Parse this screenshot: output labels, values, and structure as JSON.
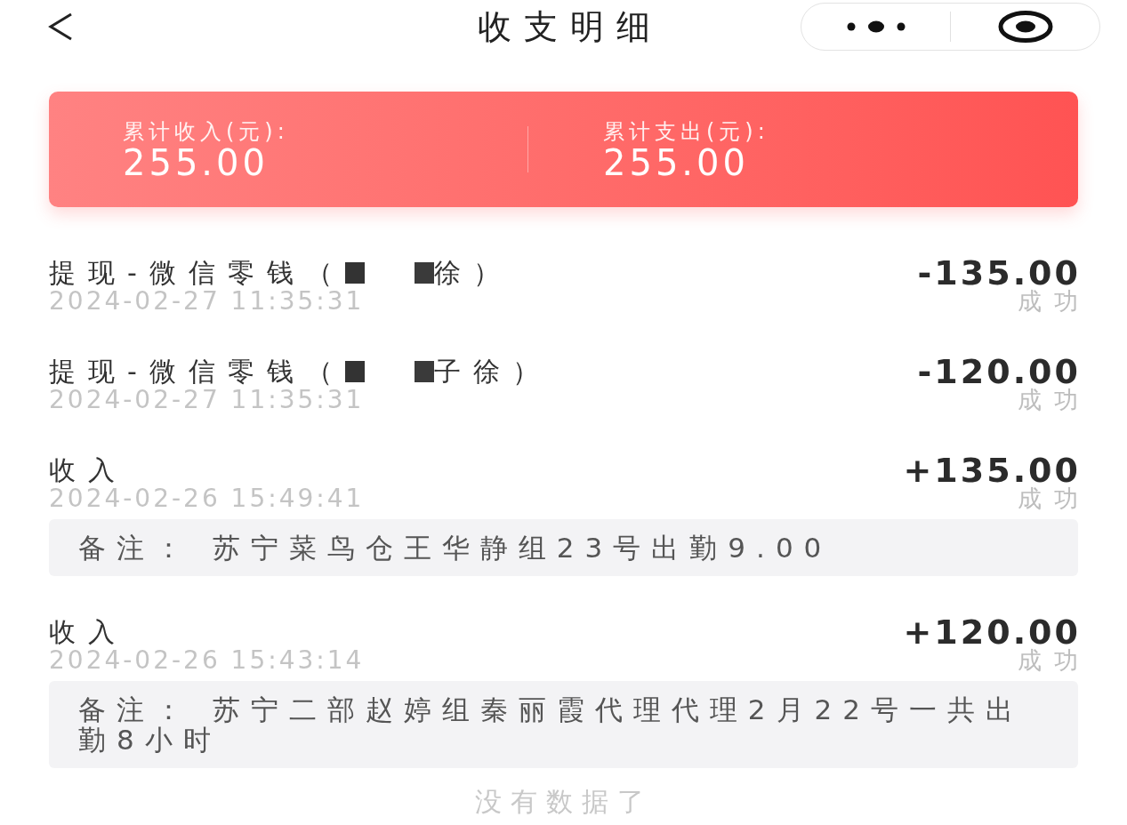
{
  "nav": {
    "title": "收支明细"
  },
  "summary": [
    {
      "label": "累计收入(元):",
      "value": "255.00"
    },
    {
      "label": "累计支出(元):",
      "value": "255.00"
    }
  ],
  "records": [
    {
      "kind": "withdrawal",
      "title": "提现-微信零钱（",
      "redacted": true,
      "title_end": "徐）",
      "time": "2024-02-27 11:35:31",
      "amount": "-135.00",
      "status": "成功"
    },
    {
      "kind": "withdrawal",
      "title": "提现-微信零钱（",
      "redacted": true,
      "title_end": "子徐）",
      "time": "2024-02-27 11:35:31",
      "amount": "-120.00",
      "status": "成功"
    },
    {
      "kind": "income",
      "title": "收入",
      "time": "2024-02-26 15:49:41",
      "amount": "+135.00",
      "status": "成功",
      "remark": "备注： 苏宁菜鸟仓王华静组23号出勤9.00"
    },
    {
      "kind": "income",
      "title": "收入",
      "time": "2024-02-26 15:43:14",
      "amount": "+120.00",
      "status": "成功",
      "remark": "备注： 苏宁二部赵婷组秦丽霞代理代理2月22号一共出勤8小时"
    }
  ],
  "footer": "没有数据了"
}
